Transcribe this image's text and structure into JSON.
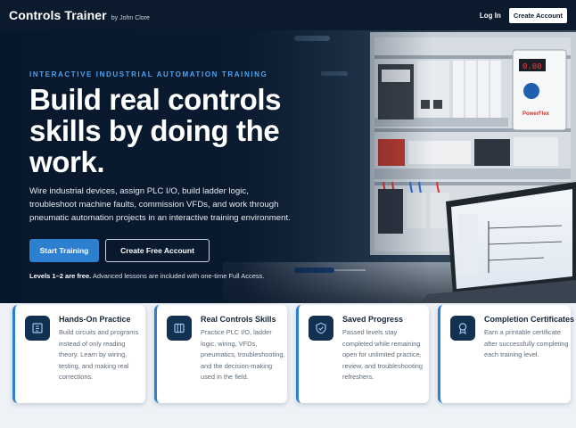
{
  "header": {
    "brand": "Controls Trainer",
    "byline": "by John Clore",
    "login": "Log In",
    "create_account": "Create Account"
  },
  "hero": {
    "eyebrow": "INTERACTIVE INDUSTRIAL AUTOMATION TRAINING",
    "headline": "Build real controls skills by doing the work.",
    "subtext": "Wire industrial devices, assign PLC I/O, build ladder logic, troubleshoot machine faults, commission VFDs, and work through pneumatic automation projects in an interactive training environment.",
    "primary_cta": "Start Training",
    "secondary_cta": "Create Free Account",
    "note_bold": "Levels 1–2 are free.",
    "note_rest": " Advanced lessons are included with one-time Full Access."
  },
  "features": [
    {
      "icon": "circuit-board-icon",
      "title": "Hands-On Practice",
      "desc": "Build circuits and programs instead of only reading theory. Learn by wiring, testing, and making real corrections."
    },
    {
      "icon": "control-panel-icon",
      "title": "Real Controls Skills",
      "desc": "Practice PLC I/O, ladder logic, wiring, VFDs, pneumatics, troubleshooting, and the decision-making used in the field."
    },
    {
      "icon": "shield-check-icon",
      "title": "Saved Progress",
      "desc": "Passed levels stay completed while remaining open for unlimited practice, review, and troubleshooting refreshers."
    },
    {
      "icon": "award-ribbon-icon",
      "title": "Completion Certificates",
      "desc": "Earn a printable certificate after successfully completing each training level."
    }
  ],
  "colors": {
    "navy": "#0b1a2c",
    "accent": "#2d7fd0",
    "eyebrow": "#4fa3f0"
  },
  "hero_image": {
    "vfd_display": "0.00",
    "vfd_brand": "PowerFlex"
  }
}
